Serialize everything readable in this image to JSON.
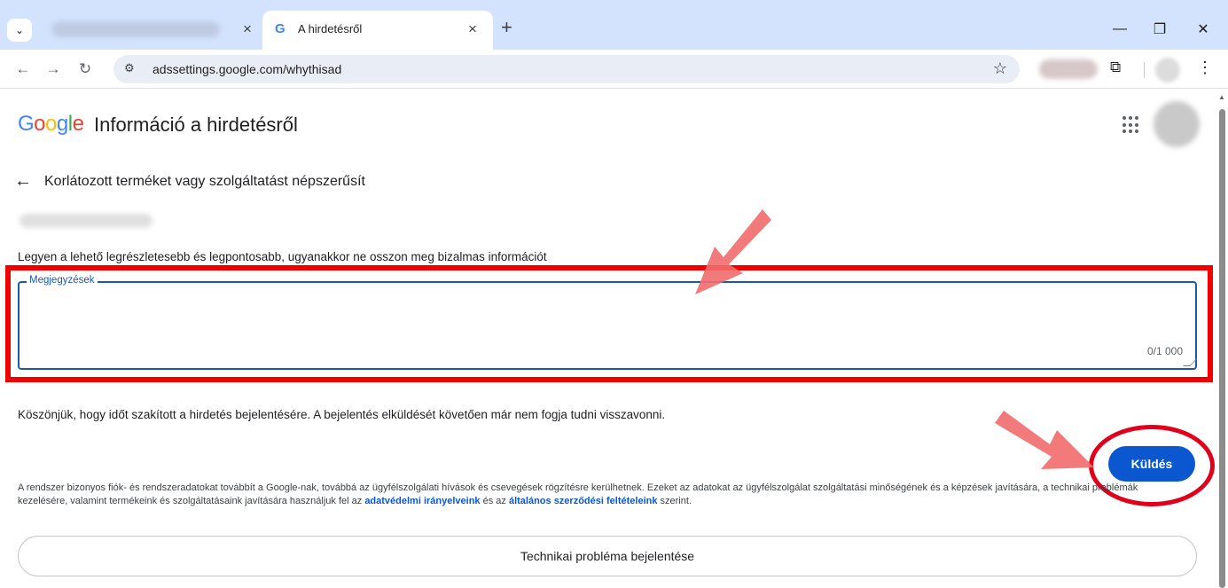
{
  "browser": {
    "active_tab": {
      "title": "A hirdetésről",
      "favicon": "G"
    },
    "url": "adssettings.google.com/whythisad"
  },
  "header": {
    "logo": "Google",
    "title": "Információ a hirdetésről"
  },
  "main": {
    "section_title": "Korlátozott terméket vagy szolgáltatást népszerűsít",
    "instructions": "Legyen a lehető legrészletesebb és legpontosabb, ugyanakkor ne osszon meg bizalmas információt",
    "notes_field": {
      "label": "Megjegyzések",
      "value": "",
      "counter": "0/1 000"
    },
    "thanks_text": "Köszönjük, hogy időt szakított a hirdetés bejelentésére. A bejelentés elküldését követően már nem fogja tudni visszavonni.",
    "submit_label": "Küldés",
    "legal": {
      "text_before": "A rendszer bizonyos fiók- és rendszeradatokat továbbít a Google-nak, továbbá az ügyfélszolgálati hívások és csevegések rögzítésre kerülhetnek. Ezeket az adatokat az ügyfélszolgálat szolgáltatási minőségének és a képzések javítására, a technikai problémák kezelésére, valamint termékeink és szolgáltatásaink javítására használjuk fel az ",
      "link1": "adatvédelmi irányelveink",
      "text_middle": " és az ",
      "link2": "általános szerződési feltételeink",
      "text_after": " szerint."
    },
    "tech_issue_label": "Technikai probléma bejelentése"
  },
  "colors": {
    "accent": "#0b57d0",
    "highlight": "#f20000",
    "arrow": "#f26b6b"
  }
}
